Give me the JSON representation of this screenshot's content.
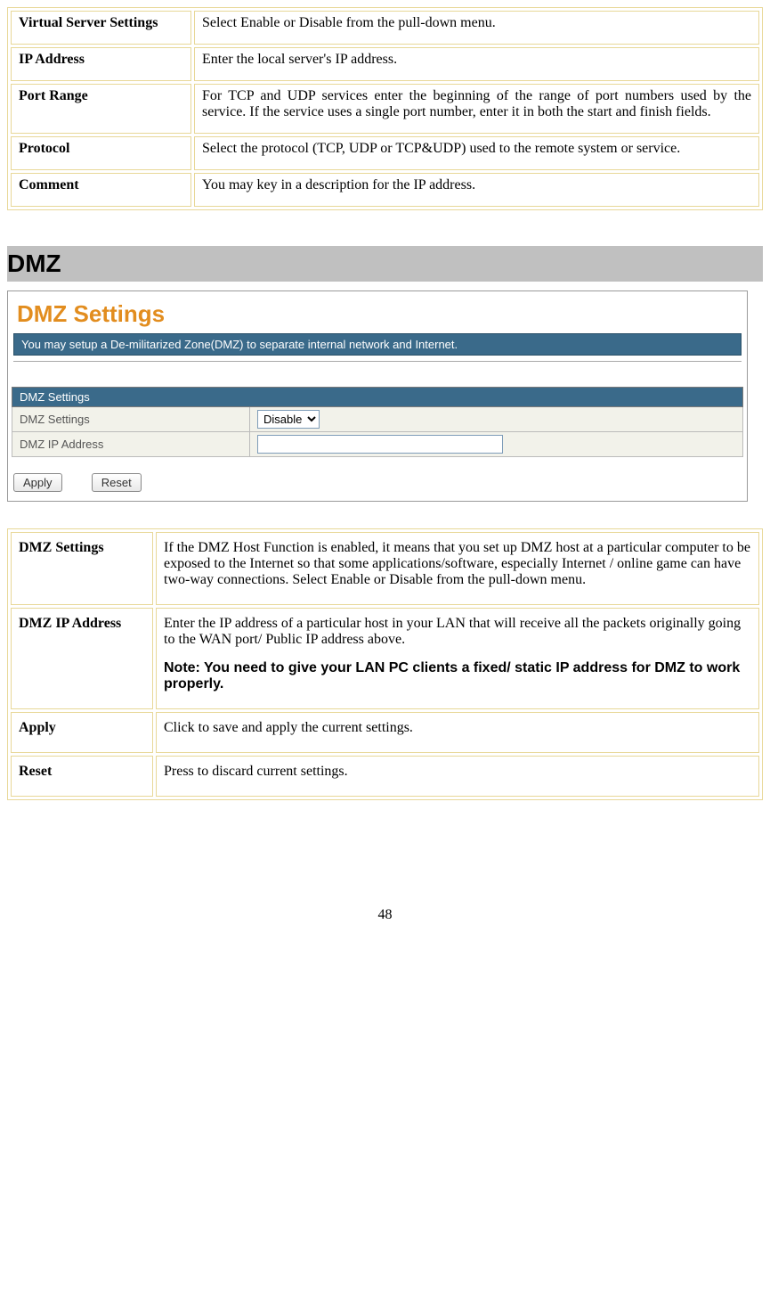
{
  "table1": {
    "rows": [
      {
        "key": "Virtual Server Settings",
        "val": "Select Enable or Disable from the pull-down menu."
      },
      {
        "key": "IP Address",
        "val": "Enter the local server's IP address."
      },
      {
        "key": "Port Range",
        "val": "For TCP and UDP services enter the beginning of the range of port numbers used by the service. If the service uses a single port number, enter it in both the start and finish fields."
      },
      {
        "key": "Protocol",
        "val": "Select the protocol (TCP, UDP or TCP&UDP) used to the remote system or service."
      },
      {
        "key": "Comment",
        "val": "You may key in a description for the IP address."
      }
    ]
  },
  "section_title": "DMZ",
  "screenshot": {
    "title": "DMZ Settings",
    "banner": "You may setup a De-militarized Zone(DMZ) to separate internal network and Internet.",
    "form_header": "DMZ Settings",
    "field1_label": "DMZ Settings",
    "field1_value": "Disable",
    "field2_label": "DMZ IP Address",
    "field2_value": "",
    "apply_label": "Apply",
    "reset_label": "Reset"
  },
  "table2": {
    "rows": [
      {
        "key": "DMZ Settings",
        "val": "If the DMZ Host Function is enabled, it means that you set up DMZ host at a particular computer to be exposed to the Internet so that some applications/software, especially Internet / online game can have two-way connections. Select Enable or Disable from the pull-down menu.",
        "note": ""
      },
      {
        "key": "DMZ IP Address",
        "val": "Enter the IP address of a particular host in your LAN that will receive all the packets originally going to the WAN port/ Public IP address above.",
        "note": "Note: You need to give your LAN PC clients a fixed/ static IP address for DMZ to work properly."
      },
      {
        "key": "Apply",
        "val": "Click to save and apply the current settings.",
        "note": ""
      },
      {
        "key": "Reset",
        "val": "Press to discard current settings.",
        "note": ""
      }
    ]
  },
  "page_number": "48"
}
